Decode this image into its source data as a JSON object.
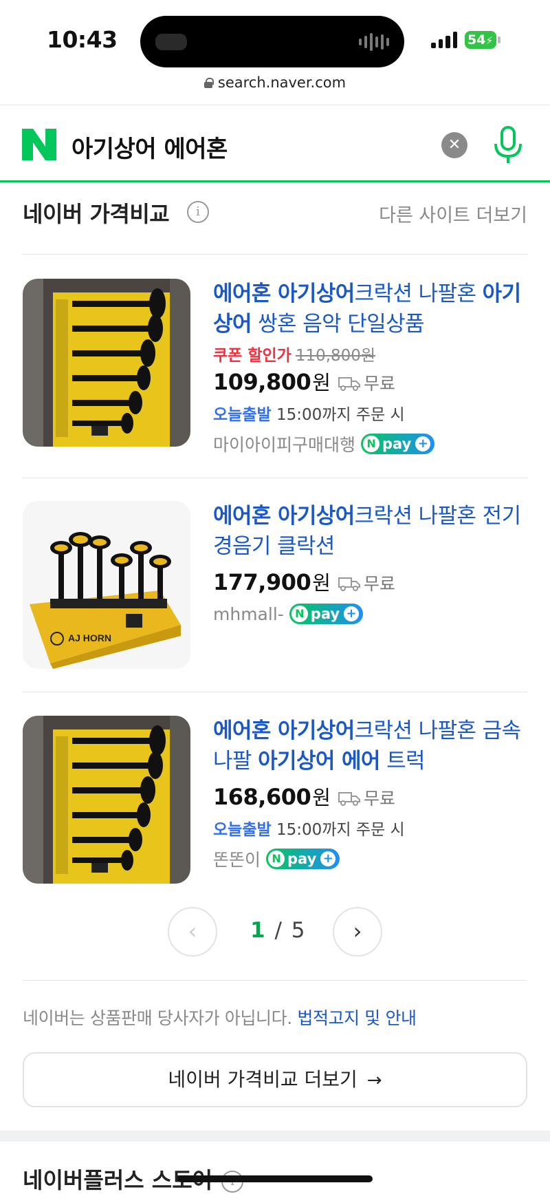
{
  "status_bar": {
    "time": "10:43",
    "battery": "54",
    "url": "search.naver.com"
  },
  "search": {
    "logo": "N",
    "query": "아기상어 에어혼",
    "clear_icon": "close-icon",
    "mic_icon": "microphone-icon",
    "brand_color": "#03c75a"
  },
  "section": {
    "title": "네이버 가격비교",
    "info_icon": "i",
    "more_link": "다른 사이트 더보기"
  },
  "products": [
    {
      "title_parts": [
        {
          "text": "에어혼 아기상어",
          "bold": true
        },
        {
          "text": "크락션 나팔혼 ",
          "bold": false
        },
        {
          "text": "아기상어",
          "bold": true
        },
        {
          "text": " 쌍혼 음악 단일상품",
          "bold": false
        }
      ],
      "coupon_label": "쿠폰 할인가",
      "old_price": "110,800원",
      "price": "109,800",
      "currency": "원",
      "shipping": "무료",
      "delivery_label": "오늘출발",
      "delivery_text": "15:00까지 주문 시",
      "seller": "마이아이피구매대행",
      "npay": "pay"
    },
    {
      "title_parts": [
        {
          "text": "에어혼 아기상어",
          "bold": true
        },
        {
          "text": "크락션 나팔혼 전기 경음기 클락션",
          "bold": false
        }
      ],
      "price": "177,900",
      "currency": "원",
      "shipping": "무료",
      "seller": "mhmall-",
      "npay": "pay",
      "box_text": "AJ HORN"
    },
    {
      "title_parts": [
        {
          "text": "에어혼 아기상어",
          "bold": true
        },
        {
          "text": "크락션 나팔혼 금속 나팔 ",
          "bold": false
        },
        {
          "text": "아기상어 에어",
          "bold": true
        },
        {
          "text": " 트럭",
          "bold": false
        }
      ],
      "price": "168,600",
      "currency": "원",
      "shipping": "무료",
      "delivery_label": "오늘출발",
      "delivery_text": "15:00까지 주문 시",
      "seller": "똔똔이",
      "npay": "pay"
    }
  ],
  "pagination": {
    "current": "1",
    "separator": "/",
    "total": "5"
  },
  "footer": {
    "disclaimer": "네이버는 상품판매 당사자가 아닙니다.",
    "legal_link": "법적고지 및 안내",
    "more_button": "네이버 가격비교 더보기",
    "next_section_title": "네이버플러스 스토어"
  }
}
